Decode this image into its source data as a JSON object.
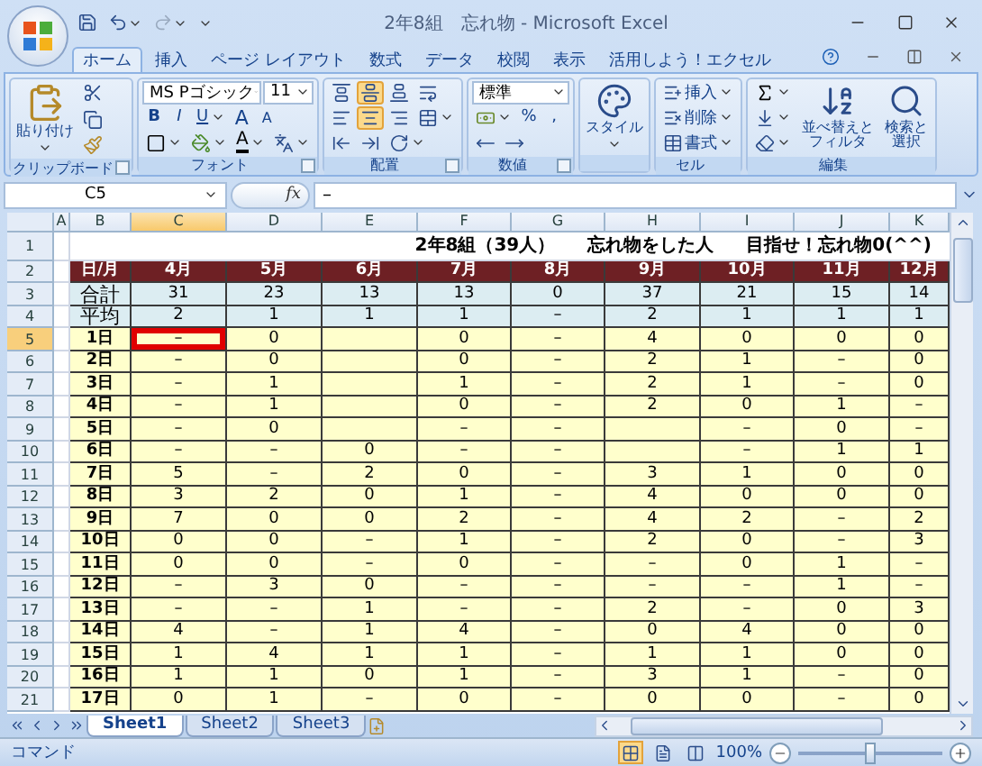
{
  "window": {
    "title": "2年8組　忘れ物 - Microsoft Excel"
  },
  "ribbon": {
    "tabs": [
      {
        "label": "ホーム",
        "selected": true
      },
      {
        "label": "挿入",
        "selected": false
      },
      {
        "label": "ページ レイアウト",
        "selected": false
      },
      {
        "label": "数式",
        "selected": false
      },
      {
        "label": "データ",
        "selected": false
      },
      {
        "label": "校閲",
        "selected": false
      },
      {
        "label": "表示",
        "selected": false
      },
      {
        "label": "活用しよう！エクセル",
        "selected": false
      }
    ],
    "groups": [
      {
        "kind": "clipboard",
        "label": "クリップボード",
        "paste": "貼り付け"
      },
      {
        "kind": "font",
        "label": "フォント",
        "font": "MS Pゴシック",
        "size": "11",
        "styles": [
          "B",
          "I",
          "U"
        ],
        "grow": "A",
        "shrink": "A",
        "font_color": "A"
      },
      {
        "kind": "alignment",
        "label": "配置",
        "vertical": [
          {
            "selected": false
          },
          {
            "selected": true
          },
          {
            "selected": false
          }
        ],
        "horizontal": [
          {
            "selected": false
          },
          {
            "selected": true
          },
          {
            "selected": false
          }
        ]
      },
      {
        "kind": "number",
        "label": "数値",
        "format": "標準",
        "percent": "%",
        "comma": ","
      },
      {
        "kind": "styles",
        "button": "スタイル"
      },
      {
        "kind": "cells",
        "label": "セル",
        "buttons": [
          "挿入",
          "削除",
          "書式"
        ]
      },
      {
        "kind": "editing",
        "label": "編集",
        "sort": "並べ替えとフィルタ",
        "find": "検索と選択"
      }
    ]
  },
  "formula_bar": {
    "name_box": "C5",
    "fx": "fx",
    "formula": "–"
  },
  "sheet": {
    "columns": [
      {
        "label": "A",
        "selected": false
      },
      {
        "label": "B",
        "selected": false
      },
      {
        "label": "C",
        "selected": true
      },
      {
        "label": "D",
        "selected": false
      },
      {
        "label": "E",
        "selected": false
      },
      {
        "label": "F",
        "selected": false
      },
      {
        "label": "G",
        "selected": false
      },
      {
        "label": "H",
        "selected": false
      },
      {
        "label": "I",
        "selected": false
      },
      {
        "label": "J",
        "selected": false
      },
      {
        "label": "K",
        "selected": false
      }
    ],
    "rows": [
      {
        "header": "1",
        "selected": false,
        "kind": "title",
        "texts": [
          "2年8組（39人）",
          "忘れ物をした人",
          "目指せ！忘れ物0(^^)"
        ]
      },
      {
        "header": "2",
        "selected": false,
        "kind": "month_header",
        "cells": [
          "",
          "日/月",
          "4月",
          "5月",
          "6月",
          "7月",
          "8月",
          "9月",
          "10月",
          "11月",
          "12月"
        ]
      },
      {
        "header": "3",
        "selected": false,
        "kind": "summary",
        "cells": [
          "",
          "合計",
          "31",
          "23",
          "13",
          "13",
          "0",
          "37",
          "21",
          "15",
          "14"
        ]
      },
      {
        "header": "4",
        "selected": false,
        "kind": "summary",
        "cells": [
          "",
          "平均",
          "2",
          "1",
          "1",
          "1",
          "–",
          "2",
          "1",
          "1",
          "1"
        ]
      },
      {
        "header": "5",
        "selected": true,
        "kind": "day",
        "cells": [
          "",
          "1日",
          "–",
          "0",
          "",
          "0",
          "–",
          "4",
          "0",
          "0",
          "0"
        ]
      },
      {
        "header": "6",
        "selected": false,
        "kind": "day",
        "cells": [
          "",
          "2日",
          "–",
          "0",
          "",
          "0",
          "–",
          "2",
          "1",
          "–",
          "0"
        ]
      },
      {
        "header": "7",
        "selected": false,
        "kind": "day",
        "cells": [
          "",
          "3日",
          "–",
          "1",
          "",
          "1",
          "–",
          "2",
          "1",
          "–",
          "0"
        ]
      },
      {
        "header": "8",
        "selected": false,
        "kind": "day",
        "cells": [
          "",
          "4日",
          "–",
          "1",
          "",
          "0",
          "–",
          "2",
          "0",
          "1",
          "–"
        ]
      },
      {
        "header": "9",
        "selected": false,
        "kind": "day",
        "cells": [
          "",
          "5日",
          "–",
          "0",
          "",
          "–",
          "–",
          "",
          "–",
          "0",
          "–"
        ]
      },
      {
        "header": "10",
        "selected": false,
        "kind": "day",
        "cells": [
          "",
          "6日",
          "–",
          "–",
          "0",
          "–",
          "–",
          "",
          "–",
          "1",
          "1"
        ]
      },
      {
        "header": "11",
        "selected": false,
        "kind": "day",
        "cells": [
          "",
          "7日",
          "5",
          "–",
          "2",
          "0",
          "–",
          "3",
          "1",
          "0",
          "0"
        ]
      },
      {
        "header": "12",
        "selected": false,
        "kind": "day",
        "cells": [
          "",
          "8日",
          "3",
          "2",
          "0",
          "1",
          "–",
          "4",
          "0",
          "0",
          "0"
        ]
      },
      {
        "header": "13",
        "selected": false,
        "kind": "day",
        "cells": [
          "",
          "9日",
          "7",
          "0",
          "0",
          "2",
          "–",
          "4",
          "2",
          "–",
          "2"
        ]
      },
      {
        "header": "14",
        "selected": false,
        "kind": "day",
        "cells": [
          "",
          "10日",
          "0",
          "0",
          "–",
          "1",
          "–",
          "2",
          "0",
          "–",
          "3"
        ]
      },
      {
        "header": "15",
        "selected": false,
        "kind": "day",
        "cells": [
          "",
          "11日",
          "0",
          "0",
          "–",
          "0",
          "–",
          "–",
          "0",
          "1",
          "–"
        ]
      },
      {
        "header": "16",
        "selected": false,
        "kind": "day",
        "cells": [
          "",
          "12日",
          "–",
          "3",
          "0",
          "–",
          "–",
          "–",
          "–",
          "1",
          "–"
        ]
      },
      {
        "header": "17",
        "selected": false,
        "kind": "day",
        "cells": [
          "",
          "13日",
          "–",
          "–",
          "1",
          "–",
          "–",
          "2",
          "–",
          "0",
          "3"
        ]
      },
      {
        "header": "18",
        "selected": false,
        "kind": "day",
        "cells": [
          "",
          "14日",
          "4",
          "–",
          "1",
          "4",
          "–",
          "0",
          "4",
          "0",
          "0"
        ]
      },
      {
        "header": "19",
        "selected": false,
        "kind": "day",
        "cells": [
          "",
          "15日",
          "1",
          "4",
          "1",
          "1",
          "–",
          "1",
          "1",
          "0",
          "0"
        ]
      },
      {
        "header": "20",
        "selected": false,
        "kind": "day",
        "cells": [
          "",
          "16日",
          "1",
          "1",
          "0",
          "1",
          "–",
          "3",
          "1",
          "–",
          "0"
        ]
      },
      {
        "header": "21",
        "selected": false,
        "kind": "day",
        "cells": [
          "",
          "17日",
          "0",
          "1",
          "–",
          "0",
          "–",
          "0",
          "0",
          "–",
          "0"
        ]
      }
    ]
  },
  "sheet_tabs": [
    {
      "label": "Sheet1",
      "selected": true
    },
    {
      "label": "Sheet2",
      "selected": false
    },
    {
      "label": "Sheet3",
      "selected": false
    }
  ],
  "status_bar": {
    "mode": "コマンド",
    "views": [
      {
        "selected": true
      },
      {
        "selected": false
      },
      {
        "selected": false
      }
    ],
    "zoom": "100%",
    "zoom_slider": {
      "level": 0.5
    }
  }
}
